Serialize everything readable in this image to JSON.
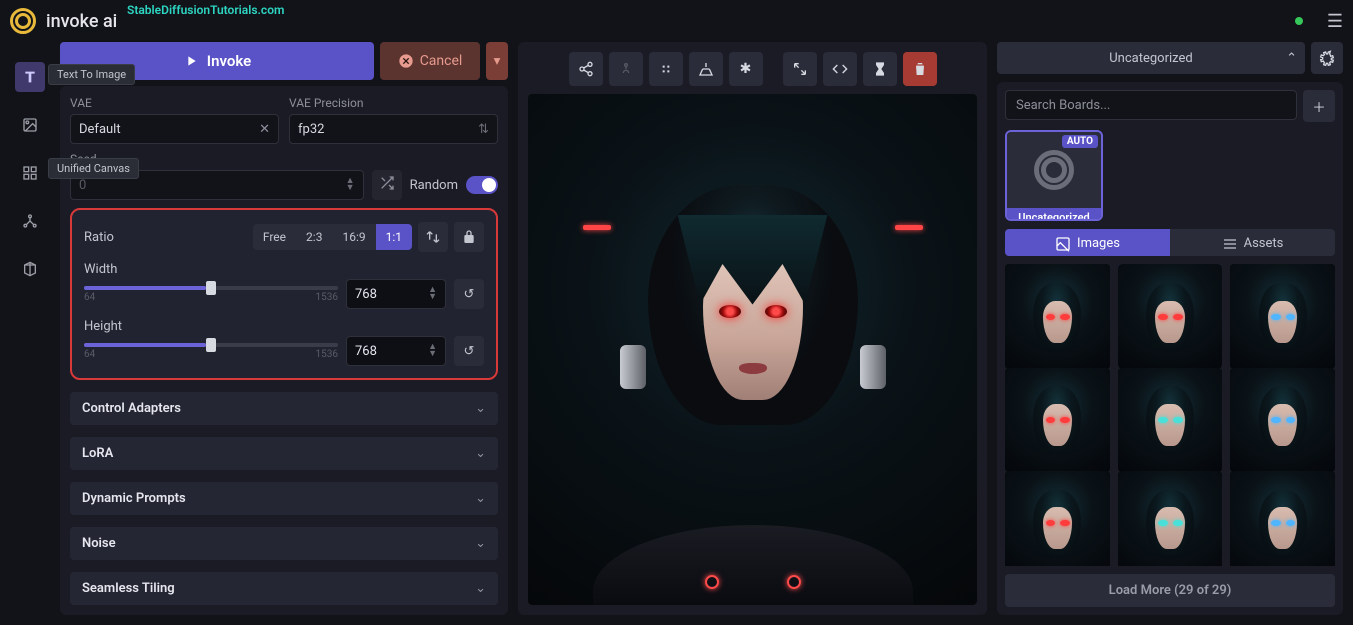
{
  "app": {
    "title": "invoke ai",
    "watermark": "StableDiffusionTutorials.com"
  },
  "rail": {
    "items": [
      "text-to-image",
      "image-to-image",
      "unified-canvas",
      "nodes",
      "model-manager"
    ],
    "tooltip1": "Text To Image",
    "tooltip2": "Unified Canvas"
  },
  "controls": {
    "invoke_label": "Invoke",
    "cancel_label": "Cancel",
    "vae_label": "VAE",
    "vae_value": "Default",
    "vae_precision_label": "VAE Precision",
    "vae_precision_value": "fp32",
    "seed_label": "Seed",
    "seed_placeholder": "0",
    "random_label": "Random",
    "ratio_label": "Ratio",
    "ratio_options": [
      "Free",
      "2:3",
      "16:9",
      "1:1"
    ],
    "width_label": "Width",
    "height_label": "Height",
    "dim_min": "64",
    "dim_max": "1536",
    "width_value": "768",
    "height_value": "768",
    "accordions": [
      "Control Adapters",
      "LoRA",
      "Dynamic Prompts",
      "Noise",
      "Seamless Tiling"
    ]
  },
  "right": {
    "board_dropdown": "Uncategorized",
    "search_placeholder": "Search Boards...",
    "board_card": {
      "badge": "AUTO",
      "label": "Uncategorized"
    },
    "tabs": {
      "images": "Images",
      "assets": "Assets"
    },
    "thumbs": [
      {
        "eye": "red",
        "sel": false
      },
      {
        "eye": "red",
        "sel": true
      },
      {
        "eye": "blue",
        "sel": false
      },
      {
        "eye": "red",
        "sel": false
      },
      {
        "eye": "cyan",
        "sel": false
      },
      {
        "eye": "blue",
        "sel": false
      },
      {
        "eye": "red",
        "sel": false
      },
      {
        "eye": "cyan",
        "sel": false
      },
      {
        "eye": "blue",
        "sel": false
      }
    ],
    "load_more": "Load More (29 of 29)"
  }
}
